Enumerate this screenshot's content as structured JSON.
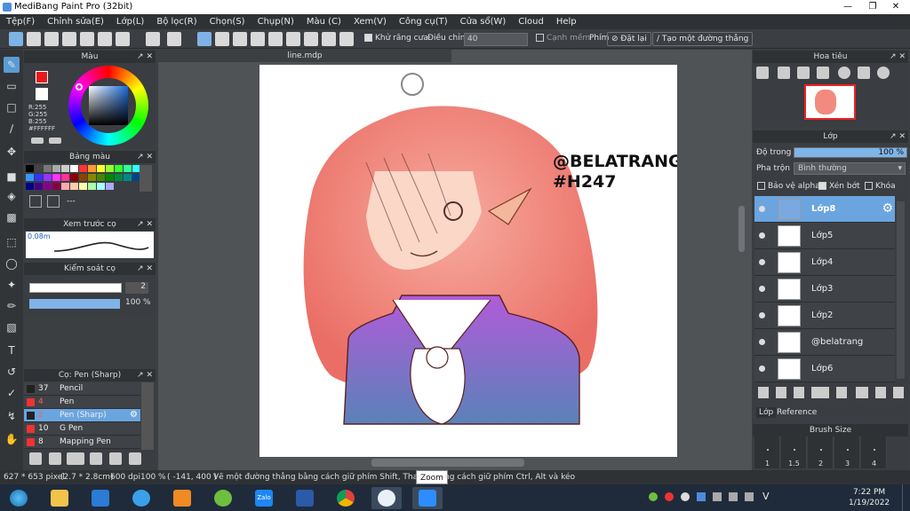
{
  "window": {
    "title": "MediBang Paint Pro (32bit)"
  },
  "menu": [
    "Tệp(F)",
    "Chỉnh sửa(E)",
    "Lớp(L)",
    "Bộ lọc(R)",
    "Chọn(S)",
    "Chụp(N)",
    "Màu (C)",
    "Xem(V)",
    "Công cụ(T)",
    "Cửa sổ(W)",
    "Cloud",
    "Help"
  ],
  "toolbar": {
    "antialias_label": "Khử răng cưa",
    "adjust_label": "Điều chỉnh",
    "adjust_value": "40",
    "sharp_edge_label": "Cạnh mềm",
    "key_label": "Phím",
    "reset_label": "Đặt lại",
    "straight_line_label": "Tạo một đường thẳng"
  },
  "color_panel": {
    "title": "Màu",
    "r": "R:255",
    "g": "G:255",
    "b": "B:255",
    "hex": "#FFFFFF",
    "primary_color": "#e8191b",
    "secondary_color": "#ffffff"
  },
  "palette_panel": {
    "title": "Bảng màu",
    "more": "---"
  },
  "brush_preview_panel": {
    "title": "Xem trước cọ",
    "size": "0.08m"
  },
  "brush_control_panel": {
    "title": "Kiểm soát cọ",
    "size_value": "2",
    "opacity_value": "100 %"
  },
  "brush_list_panel": {
    "title": "Cọ: Pen (Sharp)",
    "items": [
      {
        "size": "37",
        "name": "Pencil"
      },
      {
        "size": "4",
        "name": "Pen"
      },
      {
        "size": "2",
        "name": "Pen (Sharp)"
      },
      {
        "size": "10",
        "name": "G Pen"
      },
      {
        "size": "8",
        "name": "Mapping Pen"
      }
    ]
  },
  "document": {
    "tab": "line.mdp",
    "artwork_text_line1": "@BELATRANG",
    "artwork_text_line2": "#H247"
  },
  "navigator_panel": {
    "title": "Hoa tiêu"
  },
  "layer_panel": {
    "title": "Lớp",
    "opacity_label": "Độ trong",
    "opacity_value": "100 %",
    "opacity_fraction": 1.0,
    "blend_label": "Pha trộn",
    "blend_value": "Bình thường",
    "protect_alpha": "Bảo vệ alpha",
    "clipping": "Xén bớt",
    "lock": "Khóa",
    "layers": [
      {
        "name": "Lớp8",
        "selected": true
      },
      {
        "name": "Lớp5",
        "selected": false
      },
      {
        "name": "Lớp4",
        "selected": false
      },
      {
        "name": "Lớp3",
        "selected": false
      },
      {
        "name": "Lớp2",
        "selected": false
      },
      {
        "name": "@belatrang",
        "selected": false
      },
      {
        "name": "Lớp6",
        "selected": false
      }
    ],
    "tabs": [
      "Lớp",
      "Reference"
    ]
  },
  "brush_size_panel": {
    "title": "Brush Size",
    "sizes": [
      "1",
      "1.5",
      "2",
      "3",
      "4"
    ]
  },
  "status": {
    "dimensions": "627 * 653 pixel",
    "physical": "(2.7 * 2.8cm)",
    "dpi": "600 dpi",
    "zoom": "100 %",
    "coords": "( -141, 400 )",
    "hint": "Vẽ một đường thẳng bằng cách giữ phím Shift, Thay đổi",
    "hint2": "ng cách giữ phím Ctrl, Alt và kéo",
    "tooltip": "Zoom"
  },
  "taskbar": {
    "time": "7:22 PM",
    "date": "1/19/2022",
    "lang": "V",
    "app_icons": [
      "start-icon",
      "file-explorer-icon",
      "edge-icon",
      "ie-icon",
      "media-player-icon",
      "rocket-icon",
      "zalo-icon",
      "word-icon",
      "chrome-icon",
      "medibang-icon",
      "zoom-app-icon"
    ],
    "zalo_label": "Zalo"
  }
}
